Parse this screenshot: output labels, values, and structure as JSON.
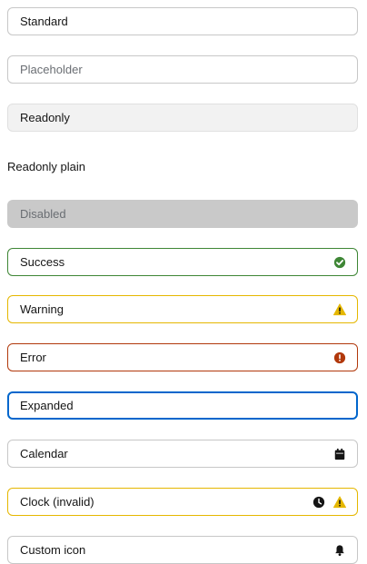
{
  "fields": {
    "standard": "Standard",
    "placeholder": "Placeholder",
    "readonly": "Readonly",
    "readonly_plain": "Readonly plain",
    "disabled": "Disabled",
    "success": "Success",
    "warning": "Warning",
    "error": "Error",
    "expanded": "Expanded",
    "calendar": "Calendar",
    "clock_invalid": "Clock (invalid)",
    "custom_icon": "Custom icon"
  },
  "icons": {
    "success": "check-circle-icon",
    "warning": "warning-triangle-icon",
    "error": "exclamation-circle-icon",
    "calendar": "calendar-icon",
    "clock": "clock-icon",
    "custom": "bell-icon"
  },
  "colors": {
    "success": "#3e8635",
    "warning": "#e5b700",
    "error": "#b1380b",
    "focus": "#0066cc",
    "icon_dark": "#151515"
  }
}
